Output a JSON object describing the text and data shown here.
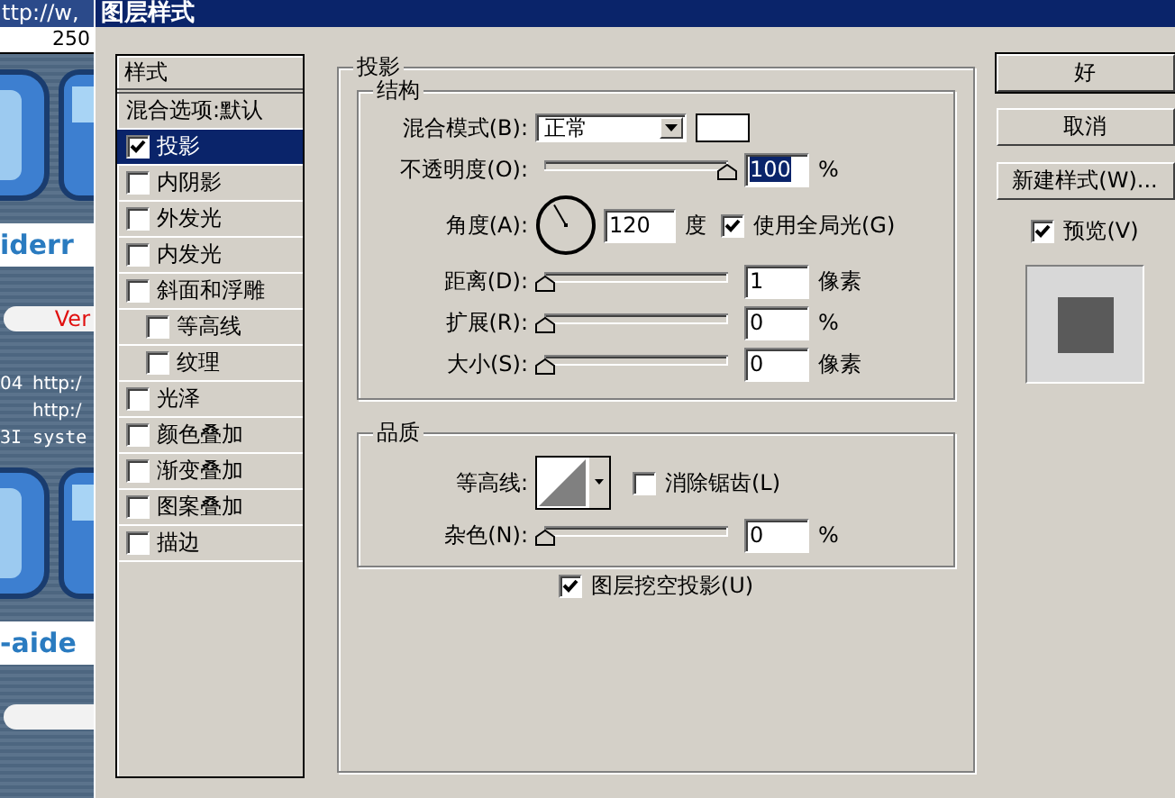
{
  "backdrop": {
    "title": "ttp://w, ",
    "ruler": "250",
    "items": [
      {
        "kind": "graphic"
      },
      {
        "kind": "band",
        "text": "iderr"
      },
      {
        "kind": "pill",
        "text": "Ver"
      },
      {
        "kind": "line",
        "lead": "04",
        "text": "http:/"
      },
      {
        "kind": "line",
        "text": "http:/"
      },
      {
        "kind": "mono",
        "text": "3I syste"
      },
      {
        "kind": "graphic"
      },
      {
        "kind": "band",
        "text": "-aide"
      },
      {
        "kind": "pill"
      }
    ]
  },
  "window": {
    "title": "图层样式"
  },
  "styles": {
    "header": "样式",
    "items": [
      {
        "label": "混合选项:默认",
        "kind": "plain",
        "selected": false
      },
      {
        "label": "投影",
        "kind": "check",
        "checked": true,
        "selected": true
      },
      {
        "label": "内阴影",
        "kind": "check",
        "checked": false,
        "selected": false
      },
      {
        "label": "外发光",
        "kind": "check",
        "checked": false,
        "selected": false
      },
      {
        "label": "内发光",
        "kind": "check",
        "checked": false,
        "selected": false
      },
      {
        "label": "斜面和浮雕",
        "kind": "check",
        "checked": false,
        "selected": false,
        "children": [
          {
            "label": "等高线",
            "kind": "check",
            "checked": false,
            "selected": false
          },
          {
            "label": "纹理",
            "kind": "check",
            "checked": false,
            "selected": false
          }
        ]
      },
      {
        "label": "光泽",
        "kind": "check",
        "checked": false,
        "selected": false
      },
      {
        "label": "颜色叠加",
        "kind": "check",
        "checked": false,
        "selected": false
      },
      {
        "label": "渐变叠加",
        "kind": "check",
        "checked": false,
        "selected": false
      },
      {
        "label": "图案叠加",
        "kind": "check",
        "checked": false,
        "selected": false
      },
      {
        "label": "描边",
        "kind": "check",
        "checked": false,
        "selected": false
      }
    ]
  },
  "panel": {
    "title": "投影",
    "structure": {
      "title": "结构",
      "rows": [
        {
          "kind": "select",
          "label": "混合模式(B):",
          "value": "正常",
          "color": "#ffffff"
        },
        {
          "kind": "slider",
          "label": "不透明度(O):",
          "level": 1,
          "value": "100",
          "unit": "%",
          "focused": true
        },
        {
          "kind": "angle",
          "label": "角度(A):",
          "value": "120",
          "unit": "度",
          "global_light": {
            "label": "使用全局光(G)",
            "checked": true
          }
        },
        {
          "kind": "slider",
          "label": "距离(D):",
          "level": 0,
          "value": "1",
          "unit": "像素",
          "focused": false
        },
        {
          "kind": "slider",
          "label": "扩展(R):",
          "level": 0,
          "value": "0",
          "unit": "%",
          "focused": false
        },
        {
          "kind": "slider",
          "label": "大小(S):",
          "level": 0,
          "value": "0",
          "unit": "像素",
          "focused": false
        }
      ]
    },
    "quality": {
      "title": "品质",
      "rows": [
        {
          "kind": "contour",
          "label": "等高线:",
          "antialias": {
            "label": "消除锯齿(L)",
            "checked": false
          }
        },
        {
          "kind": "slider",
          "label": "杂色(N):",
          "level": 0,
          "value": "0",
          "unit": "%",
          "focused": false
        }
      ]
    },
    "knockout": {
      "label": "图层挖空投影(U)",
      "checked": true
    }
  },
  "buttons": [
    {
      "label": "好",
      "default": true
    },
    {
      "label": "取消",
      "default": false
    },
    {
      "label": "新建样式(W)...",
      "default": false
    }
  ],
  "preview": {
    "label": "预览(V)",
    "checked": true
  }
}
